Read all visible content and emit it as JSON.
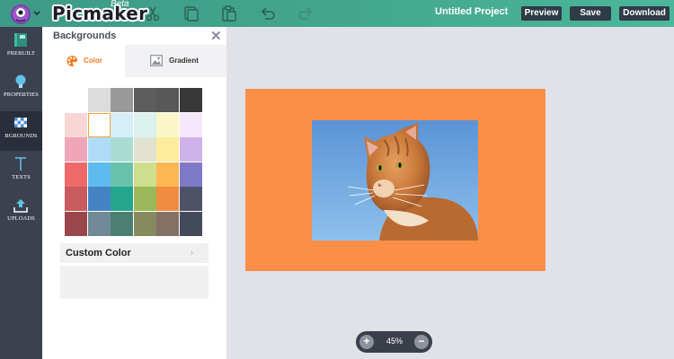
{
  "app": {
    "logo": "Picmaker",
    "beta_label": "Beta"
  },
  "toolbar": {
    "icons": [
      "scissors-icon",
      "copy-icon",
      "paste-icon",
      "undo-icon",
      "redo-icon"
    ],
    "project_title": "Untitled Project",
    "preview_label": "Preview",
    "save_label": "Save",
    "download_label": "Download"
  },
  "sidebar": {
    "items": [
      {
        "label": "PREBUILT",
        "icon": "prebuilt-icon",
        "active": false
      },
      {
        "label": "PROPERTIES",
        "icon": "lightbulb-icon",
        "active": false
      },
      {
        "label": "BGROUNDS",
        "icon": "checker-icon",
        "active": true
      },
      {
        "label": "TEXTS",
        "icon": "text-icon",
        "active": false
      },
      {
        "label": "UPLOADS",
        "icon": "upload-icon",
        "active": false
      }
    ]
  },
  "panel": {
    "title": "Backgrounds",
    "close_icon": "close-icon",
    "tabs": [
      {
        "label": "Color",
        "icon": "palette-icon",
        "active": true,
        "color": "#f27a1a"
      },
      {
        "label": "Gradient",
        "icon": "image-icon",
        "active": false,
        "color": "#333333"
      }
    ],
    "swatches": [
      [
        "",
        "#dcdcdc",
        "#999999",
        "#5d5d5d",
        "#585858",
        "#383838"
      ],
      [
        "#f9d6d6",
        "#ffffff",
        "#d6eef7",
        "#daf1ed",
        "#faf6c8",
        "#f6e8fb"
      ],
      [
        "#f0a6b9",
        "#afdcf6",
        "#a9ddd4",
        "#e1e3d0",
        "#fcec9c",
        "#cfb2ea"
      ],
      [
        "#ee6a6a",
        "#5ebaee",
        "#69c2ac",
        "#cfde8c",
        "#fdb752",
        "#7f79c8"
      ],
      [
        "#c95a5d",
        "#4584c4",
        "#25a58e",
        "#99b95a",
        "#f08c40",
        "#4f5168"
      ],
      [
        "#9a464a",
        "#718a98",
        "#4a7f72",
        "#868a5e",
        "#847064",
        "#434a5a"
      ]
    ],
    "selected_swatch": "#ffffff",
    "custom_color_label": "Custom Color",
    "custom_chevron": "›"
  },
  "canvas": {
    "background_color": "#fb8f47",
    "photo_icon": "cat-photo"
  },
  "zoom": {
    "value": "45%",
    "plus": "+",
    "minus": "−"
  }
}
